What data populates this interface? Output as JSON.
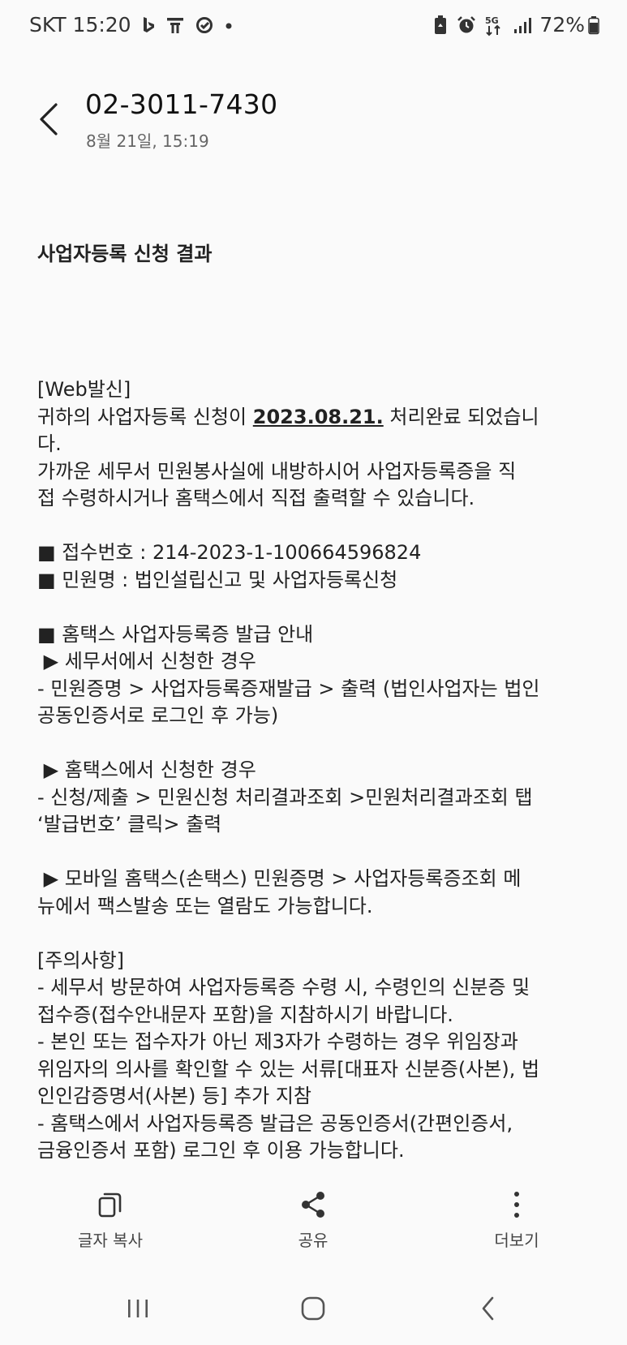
{
  "status_bar": {
    "carrier_time": "SKT 15:20",
    "notification_icons": [
      "bing-icon",
      "tmap-icon",
      "sync-icon",
      "dot-icon"
    ],
    "right_icons": [
      "recycle-battery-icon",
      "alarm-icon",
      "5g-icon",
      "signal-icon"
    ],
    "battery": "72%"
  },
  "header": {
    "title": "02-3011-7430",
    "date": "8월 21일, 15:19"
  },
  "message": {
    "subject": "사업자등록 신청 결과",
    "lines": [
      "",
      "[Web발신]",
      "__DATE_LINE__",
      "다.",
      "가까운 세무서 민원봉사실에 내방하시어 사업자등록증을 직",
      "접 수령하시거나 홈택스에서 직접 출력할 수 있습니다.",
      "",
      "■ 접수번호 : 214-2023-1-100664596824",
      "■ 민원명 : 법인설립신고 및 사업자등록신청",
      "",
      "■ 홈택스 사업자등록증 발급 안내",
      " ▶ 세무서에서 신청한 경우",
      "- 민원증명 > 사업자등록증재발급 > 출력 (법인사업자는 법인",
      "공동인증서로 로그인 후 가능)",
      "",
      " ▶ 홈택스에서 신청한 경우",
      "- 신청/제출 > 민원신청 처리결과조회 >민원처리결과조회 탭",
      "‘발급번호’ 클릭> 출력",
      "",
      " ▶ 모바일 홈택스(손택스) 민원증명 > 사업자등록증조회 메",
      "뉴에서 팩스발송 또는 열람도 가능합니다.",
      "",
      "[주의사항]",
      "- 세무서 방문하여 사업자등록증 수령 시, 수령인의 신분증 및",
      "접수증(접수안내문자 포함)을 지참하시기 바랍니다.",
      "- 본인 또는 접수자가 아닌 제3자가 수령하는 경우 위임장과",
      "위임자의 의사를 확인할 수 있는 서류[대표자 신분증(사본), 법",
      "인인감증명서(사본) 등] 추가 지참",
      "- 홈택스에서 사업자등록증 발급은 공동인증서(간편인증서,",
      "금융인증서 포함) 로그인 후 이용 가능합니다."
    ],
    "date_line": {
      "before": "귀하의 사업자등록 신청이 ",
      "date": "2023.08.21.",
      "after": " 처리완료 되었습니"
    }
  },
  "actions": {
    "copy_label": "글자 복사",
    "share_label": "공유",
    "more_label": "더보기"
  },
  "nav": {
    "recent": "recent-apps-icon",
    "home": "home-icon",
    "back": "back-icon"
  }
}
